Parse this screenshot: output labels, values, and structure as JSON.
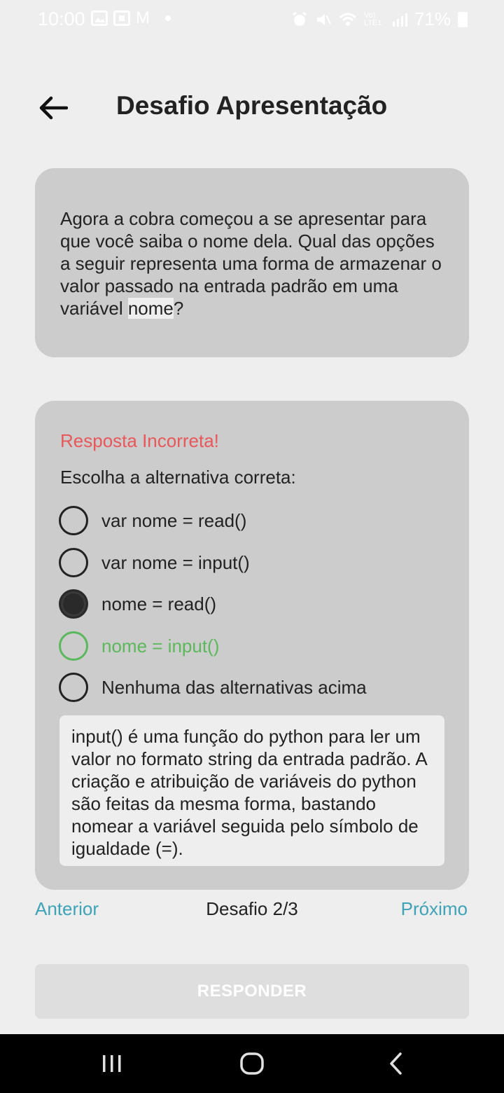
{
  "status_bar": {
    "time": "10:00",
    "mail_glyph": "M",
    "signal_text": "Vo) LTE1",
    "battery_percent": "71%",
    "icons": [
      "image-icon",
      "calendar-icon",
      "gmail-icon",
      "dot-icon",
      "alarm-icon",
      "mute-icon",
      "wifi-icon",
      "signal-icon",
      "battery-icon"
    ]
  },
  "header": {
    "title": "Desafio Apresentação",
    "back_icon": "arrow-left-icon"
  },
  "question": {
    "text_before": "Agora a cobra começou a se apresentar para que você saiba o nome dela. Qual das opções a seguir representa uma forma de armazenar o valor passado na entrada padrão em uma variável ",
    "code": "nome",
    "text_after": "?"
  },
  "answer": {
    "feedback": "Resposta Incorreta!",
    "instruction": "Escolha a alternativa correta:",
    "options": [
      {
        "label": "var nome = read()",
        "state": "unselected"
      },
      {
        "label": "var nome = input()",
        "state": "unselected"
      },
      {
        "label": "nome = read()",
        "state": "selected"
      },
      {
        "label": "nome = input()",
        "state": "correct"
      },
      {
        "label": "Nenhuma das alternativas acima",
        "state": "unselected"
      }
    ],
    "explanation": "input() é uma função do python para ler um valor no formato string da entrada padrão. A criação e atribuição de variáveis do python são feitas da mesma forma, bastando nomear a variável seguida pelo símbolo de igualdade (=)."
  },
  "navigation": {
    "prev_label": "Anterior",
    "progress_label": "Desafio 2/3",
    "next_label": "Próximo"
  },
  "respond_button_label": "RESPONDER",
  "colors": {
    "background": "#eeeeee",
    "card": "#cccccc",
    "incorrect": "#e8585a",
    "correct": "#5cb85c",
    "link": "#3fa3b8",
    "disabled_button": "#dedede"
  },
  "system_nav": {
    "icons": [
      "recents-icon",
      "home-icon",
      "back-icon"
    ]
  }
}
